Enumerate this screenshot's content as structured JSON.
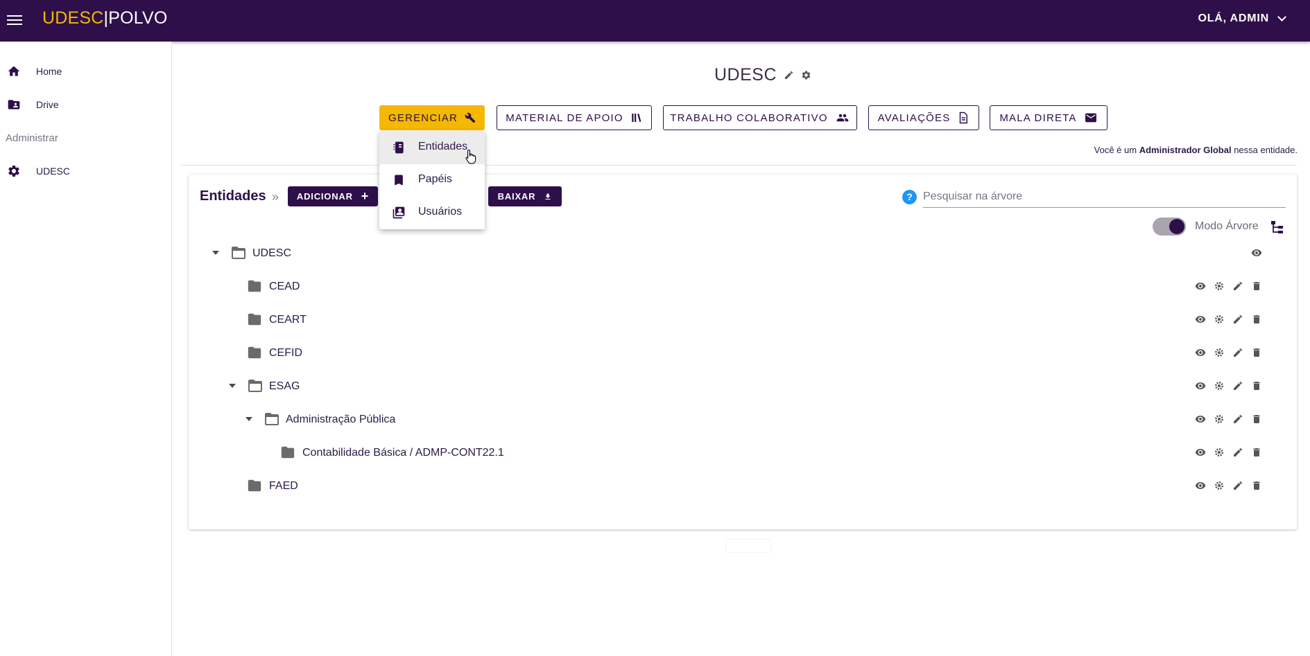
{
  "header": {
    "brand_part1": "UDESC",
    "brand_separator": "|",
    "brand_part2": "POLVO",
    "user_greeting": "OLÁ, ADMIN",
    "background_color": "#2e0f4a",
    "brand_accent": "#f5b800"
  },
  "sidebar": {
    "items": [
      {
        "label": "Home",
        "icon": "home-icon"
      },
      {
        "label": "Drive",
        "icon": "drive-folder-icon"
      }
    ],
    "section_label": "Administrar",
    "admin_items": [
      {
        "label": "UDESC",
        "icon": "gear-icon"
      }
    ]
  },
  "page": {
    "title": "UDESC",
    "info_prefix": "Você é um ",
    "info_role": "Administrador Global",
    "info_suffix": " nessa entidade."
  },
  "toolbar": {
    "gerenciar": "GERENCIAR",
    "material": "MATERIAL DE APOIO",
    "trabalho": "TRABALHO COLABORATIVO",
    "avaliacoes": "AVALIAÇÕES",
    "mala": "MALA DIRETA"
  },
  "dropdown": {
    "items": [
      {
        "label": "Entidades",
        "icon": "book-icon"
      },
      {
        "label": "Papéis",
        "icon": "bookmark-icon"
      },
      {
        "label": "Usuários",
        "icon": "contacts-icon"
      }
    ]
  },
  "entities": {
    "title": "Entidades",
    "crumb_sep": "»",
    "add_label": "ADICIONAR",
    "download_label": "BAIXAR",
    "search_placeholder": "Pesquisar na árvore",
    "tree_mode_label": "Modo Árvore",
    "tree_mode_on": true,
    "rows": [
      {
        "label": "UDESC",
        "level": 0,
        "expanded": true,
        "actions": [
          "view"
        ]
      },
      {
        "label": "CEAD",
        "level": 1,
        "expanded": false,
        "actions": [
          "view",
          "settings",
          "edit",
          "delete"
        ]
      },
      {
        "label": "CEART",
        "level": 1,
        "expanded": false,
        "actions": [
          "view",
          "settings",
          "edit",
          "delete"
        ]
      },
      {
        "label": "CEFID",
        "level": 1,
        "expanded": false,
        "actions": [
          "view",
          "settings",
          "edit",
          "delete"
        ]
      },
      {
        "label": "ESAG",
        "level": 1,
        "expanded": true,
        "actions": [
          "view",
          "settings",
          "edit",
          "delete"
        ]
      },
      {
        "label": "Administração Pública",
        "level": 2,
        "expanded": true,
        "actions": [
          "view",
          "settings",
          "edit",
          "delete"
        ]
      },
      {
        "label": "Contabilidade Básica / ADMP-CONT22.1",
        "level": 3,
        "expanded": false,
        "actions": [
          "view",
          "settings",
          "edit",
          "delete"
        ]
      },
      {
        "label": "FAED",
        "level": 1,
        "expanded": false,
        "actions": [
          "view",
          "settings",
          "edit",
          "delete"
        ]
      }
    ]
  }
}
